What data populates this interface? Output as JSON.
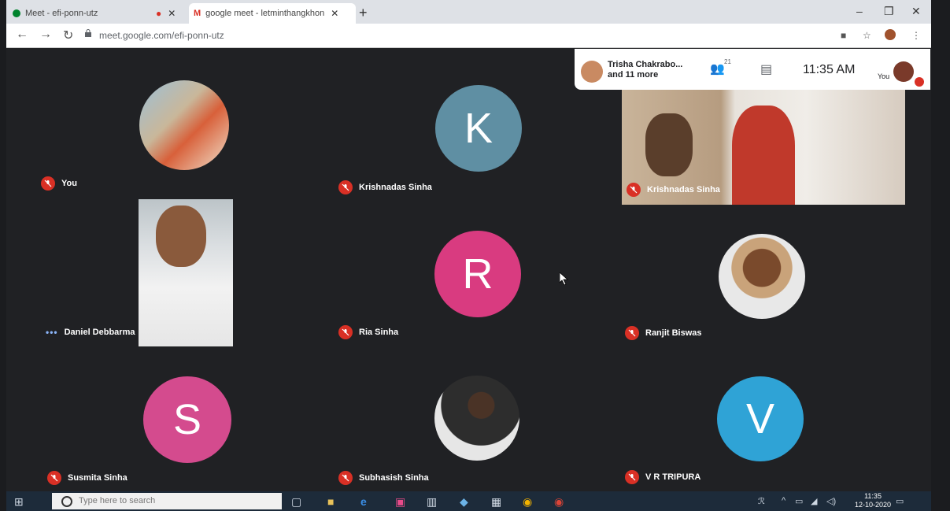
{
  "browser": {
    "tabs": [
      {
        "label": "Meet - efi-ponn-utz",
        "active": false
      },
      {
        "label": "google meet - letminthangkhon",
        "active": true
      }
    ],
    "url": "meet.google.com/efi-ponn-utz"
  },
  "meet_header": {
    "participants_line1": "Trisha Chakrabo...",
    "participants_line2": "and 11 more",
    "participant_count": "21",
    "time": "11:35 AM",
    "self_label": "You"
  },
  "tiles": [
    {
      "name": "You",
      "type": "photo",
      "muted": true
    },
    {
      "name": "Krishnadas Sinha",
      "type": "avatar",
      "initial": "K",
      "color": "#5f8fa3",
      "muted": true
    },
    {
      "name": "Krishnadas Sinha",
      "type": "video",
      "muted": true
    },
    {
      "name": "Daniel Debbarma",
      "type": "video",
      "muted": false,
      "speaking": true
    },
    {
      "name": "Ria Sinha",
      "type": "avatar",
      "initial": "R",
      "color": "#d93b80",
      "muted": true
    },
    {
      "name": "Ranjit Biswas",
      "type": "photo",
      "muted": true
    },
    {
      "name": "Susmita Sinha",
      "type": "avatar",
      "initial": "S",
      "color": "#d44b8e",
      "muted": true
    },
    {
      "name": "Subhasish Sinha",
      "type": "photo",
      "muted": true
    },
    {
      "name": "V R TRIPURA",
      "type": "avatar",
      "initial": "V",
      "color": "#2fa3d6",
      "muted": true
    }
  ],
  "taskbar": {
    "search_placeholder": "Type here to search",
    "time": "11:35",
    "date": "12-10-2020"
  },
  "icons": [
    "back-icon",
    "forward-icon",
    "reload-icon",
    "lock-icon",
    "camera-icon",
    "star-icon",
    "menu-icon",
    "people-icon",
    "chat-icon",
    "mic-off-icon",
    "windows-start-icon",
    "search-icon",
    "task-view-icon",
    "file-explorer-icon",
    "edge-icon",
    "store-icon",
    "calculator-icon",
    "chrome-icon",
    "notification-icon"
  ]
}
